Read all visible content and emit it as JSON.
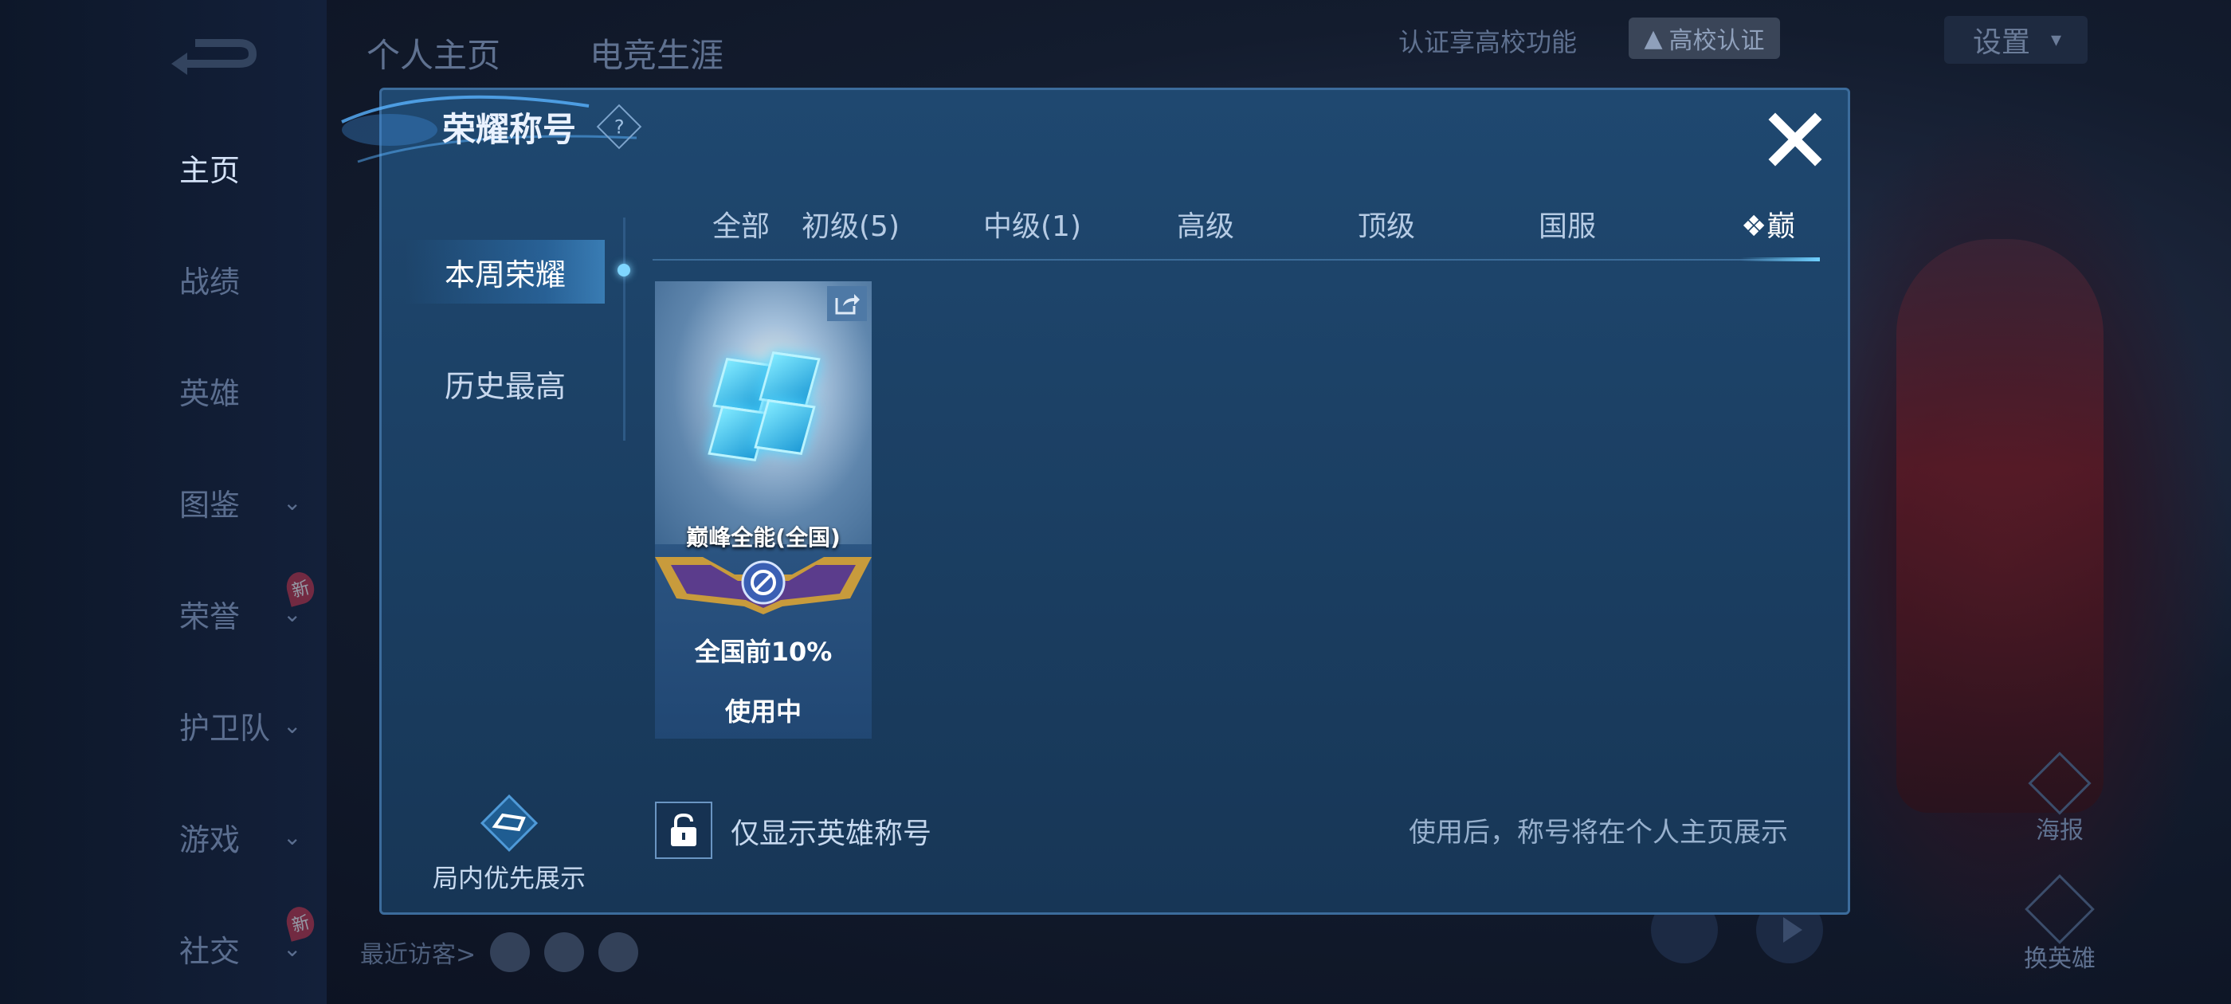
{
  "background": {
    "top_tabs": [
      "个人主页",
      "电竞生涯"
    ],
    "nav_items": [
      {
        "label": "主页",
        "active": true,
        "chevron": false,
        "badge": ""
      },
      {
        "label": "战绩",
        "active": false,
        "chevron": false,
        "badge": ""
      },
      {
        "label": "英雄",
        "active": false,
        "chevron": false,
        "badge": ""
      },
      {
        "label": "图鉴",
        "active": false,
        "chevron": true,
        "badge": ""
      },
      {
        "label": "荣誉",
        "active": false,
        "chevron": true,
        "badge": "新"
      },
      {
        "label": "护卫队",
        "active": false,
        "chevron": true,
        "badge": ""
      },
      {
        "label": "游戏",
        "active": false,
        "chevron": true,
        "badge": ""
      },
      {
        "label": "社交",
        "active": false,
        "chevron": true,
        "badge": "新"
      }
    ],
    "cert_text": "认证享高校功能",
    "uni_cert_label": "高校认证",
    "settings_label": "设置",
    "recent_visitors_label": "最近访客>",
    "poster_label": "海报",
    "swap_hero_label": "换英雄"
  },
  "modal": {
    "title": "荣耀称号",
    "help_icon": "question-diamond-icon",
    "close_icon": "close-x-icon",
    "side_tabs": [
      {
        "label": "本周荣耀",
        "active": true
      },
      {
        "label": "历史最高",
        "active": false
      }
    ],
    "category_tabs": [
      {
        "label": "全部",
        "active": false
      },
      {
        "label": "初级(5)",
        "active": false
      },
      {
        "label": "中级(1)",
        "active": false
      },
      {
        "label": "高级",
        "active": false
      },
      {
        "label": "顶级",
        "active": false
      },
      {
        "label": "国服",
        "active": false
      },
      {
        "label": "❖巅",
        "active": true
      }
    ],
    "cards": [
      {
        "name": "巅峰全能(全国)",
        "rank": "全国前10%",
        "status": "使用中"
      }
    ],
    "lock_label": "仅显示英雄称号",
    "hint": "使用后，称号将在个人主页展示",
    "priority_label": "局内优先展示"
  },
  "colors": {
    "modal_bg": "#1d4268",
    "modal_border": "#3c6c9c",
    "accent": "#6fd0ff",
    "text_primary": "#ffffff"
  }
}
